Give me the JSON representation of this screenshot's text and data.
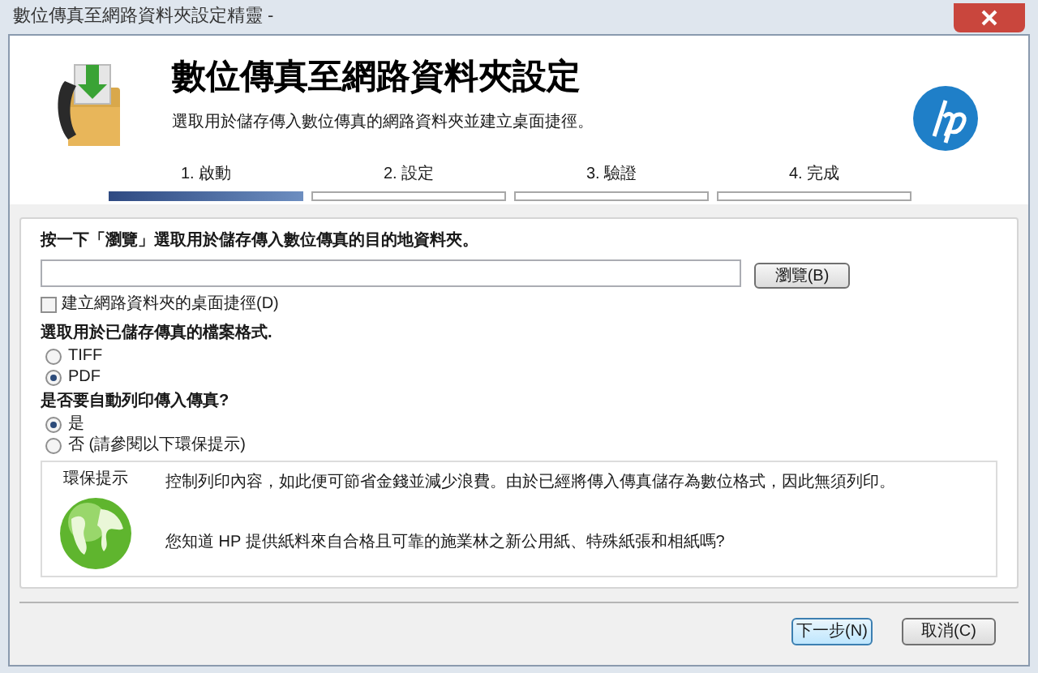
{
  "window": {
    "title": "數位傳真至網路資料夾設定精靈 -"
  },
  "header": {
    "title": "數位傳真至網路資料夾設定",
    "subtitle": "選取用於儲存傳入數位傳真的網路資料夾並建立桌面捷徑。"
  },
  "steps": [
    {
      "label": "1. 啟動",
      "active": true
    },
    {
      "label": "2. 設定",
      "active": false
    },
    {
      "label": "3. 驗證",
      "active": false
    },
    {
      "label": "4. 完成",
      "active": false
    }
  ],
  "folder": {
    "heading": "按一下「瀏覽」選取用於儲存傳入數位傳真的目的地資料夾。",
    "browse_button": "瀏覽(B)",
    "shortcut": {
      "label": "建立網路資料夾的桌面捷徑(D)",
      "checked": false
    }
  },
  "format": {
    "heading": "選取用於已儲存傳真的檔案格式.",
    "options": [
      {
        "label": "TIFF",
        "selected": false
      },
      {
        "label": "PDF",
        "selected": true
      }
    ]
  },
  "print": {
    "heading": "是否要自動列印傳入傳真?",
    "options": [
      {
        "label": "是",
        "selected": true
      },
      {
        "label": "否 (請參閱以下環保提示)",
        "selected": false
      }
    ]
  },
  "eco_tip": {
    "title": "環保提示",
    "lines": [
      "控制列印內容，如此便可節省金錢並減少浪費。由於已經將傳入傳真儲存為數位格式，因此無須列印。",
      "您知道 HP 提供紙料來自合格且可靠的施業林之新公用紙、特殊紙張和相紙嗎?"
    ]
  },
  "buttons": [
    "下一步(N)",
    "取消(C)"
  ]
}
